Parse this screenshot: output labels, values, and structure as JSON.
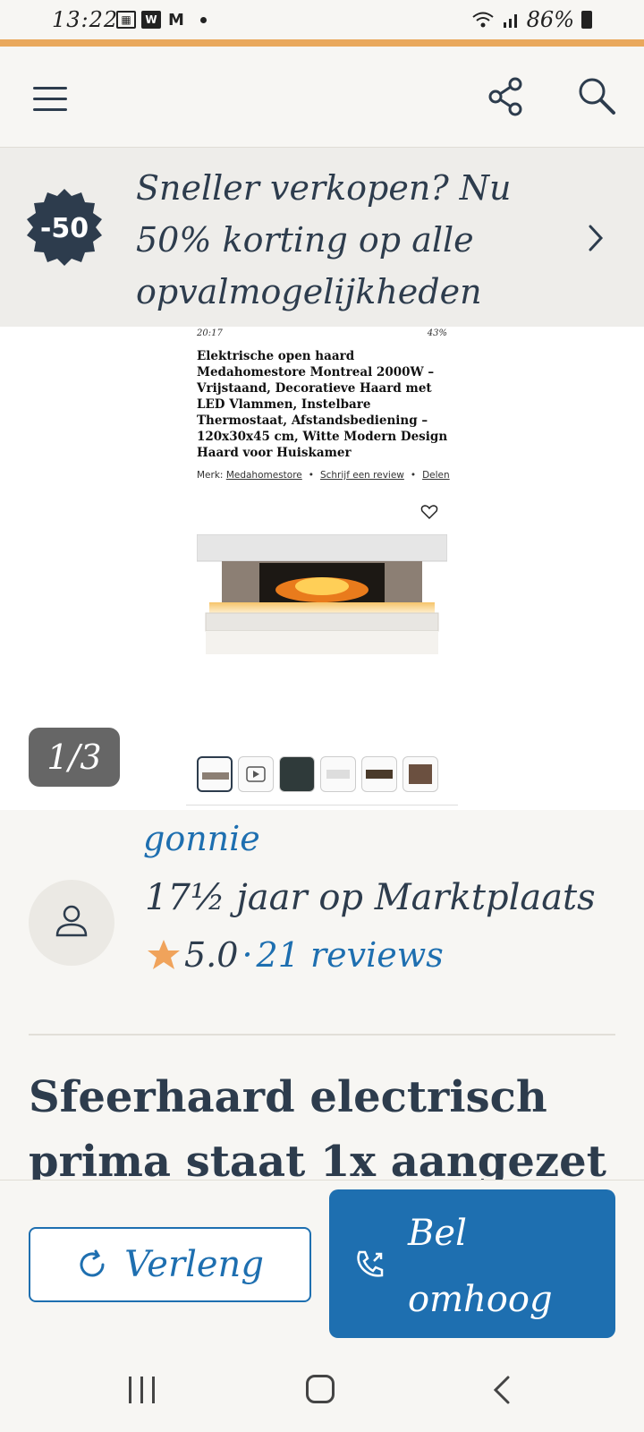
{
  "status_bar": {
    "time": "13:22",
    "left_icons": [
      "calendar-icon",
      "w-app-icon",
      "gmail-icon",
      "dot-icon"
    ],
    "battery": "86%"
  },
  "header": {
    "menu_icon": "hamburger-icon",
    "share_icon": "share-icon",
    "search_icon": "search-icon"
  },
  "promo": {
    "badge": "-50",
    "text": "Sneller verkopen? Nu 50% korting op alle opvalmogelijkheden"
  },
  "gallery": {
    "counter": "1/3",
    "screenshot": {
      "status_time": "20:17",
      "status_battery": "43%",
      "title": "Elektrische open haard Medahomestore Montreal 2000W – Vrijstaand, Decoratieve Haard met LED Vlammen, Instelbare Thermostaat, Afstandsbediening – 120x30x45 cm, Witte Modern Design Haard voor Huiskamer",
      "brand_prefix": "Merk:",
      "brand": "Medahomestore",
      "review_link": "Schrijf een review",
      "share_link": "Delen"
    }
  },
  "seller": {
    "name": "gonnie",
    "since": "17½ jaar op Marktplaats",
    "score": "5.0",
    "separator": "·",
    "reviews": "21 reviews"
  },
  "listing": {
    "title": "Sfeerhaard electrisch prima staat 1x aangezet"
  },
  "actions": {
    "extend_label": "Verleng",
    "bump_label_line1": "Bel",
    "bump_label_line2": "omhoog"
  },
  "colors": {
    "accent_orange": "#e9a85c",
    "brand_blue": "#1e6fb0",
    "text_dark": "#2d3c4d",
    "star": "#f0a35b"
  }
}
